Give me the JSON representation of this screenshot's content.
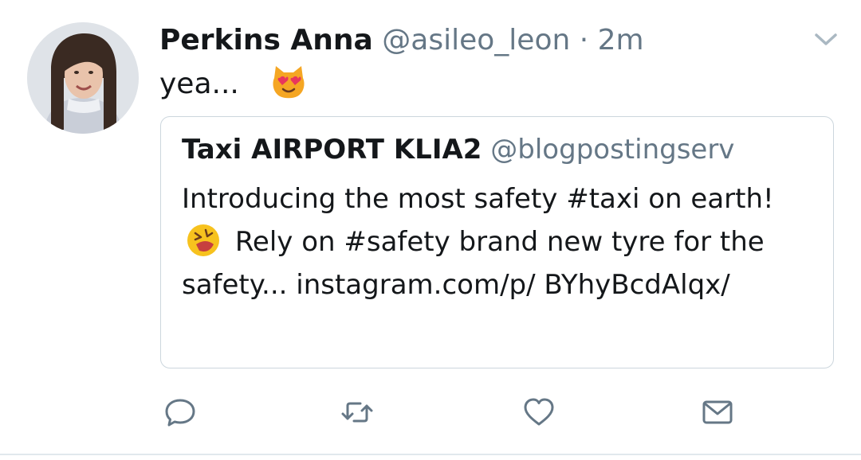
{
  "tweet": {
    "author_name": "Perkins Anna",
    "author_handle": "@asileo_leon",
    "separator": "·",
    "time": "2m",
    "text": "yea...",
    "text_emoji": "smiling-cat-heart-eyes-emoji"
  },
  "quoted_tweet": {
    "author_name": "Taxi AIRPORT KLIA2",
    "author_handle": "@blogpostingserv",
    "text_part1": "Introducing the most safety #taxi on earth!",
    "text_part2": "Rely on #safety brand new tyre for the safety... instagram.com/p/ BYhyBcdAlqx/",
    "text_emoji": "rolling-on-floor-laughing-emoji"
  },
  "actions": {
    "reply_icon": "reply-icon",
    "retweet_icon": "retweet-icon",
    "like_icon": "heart-icon",
    "message_icon": "envelope-icon"
  },
  "colors": {
    "text_primary": "#14171a",
    "text_secondary": "#657786",
    "border": "#ccd6dd"
  }
}
